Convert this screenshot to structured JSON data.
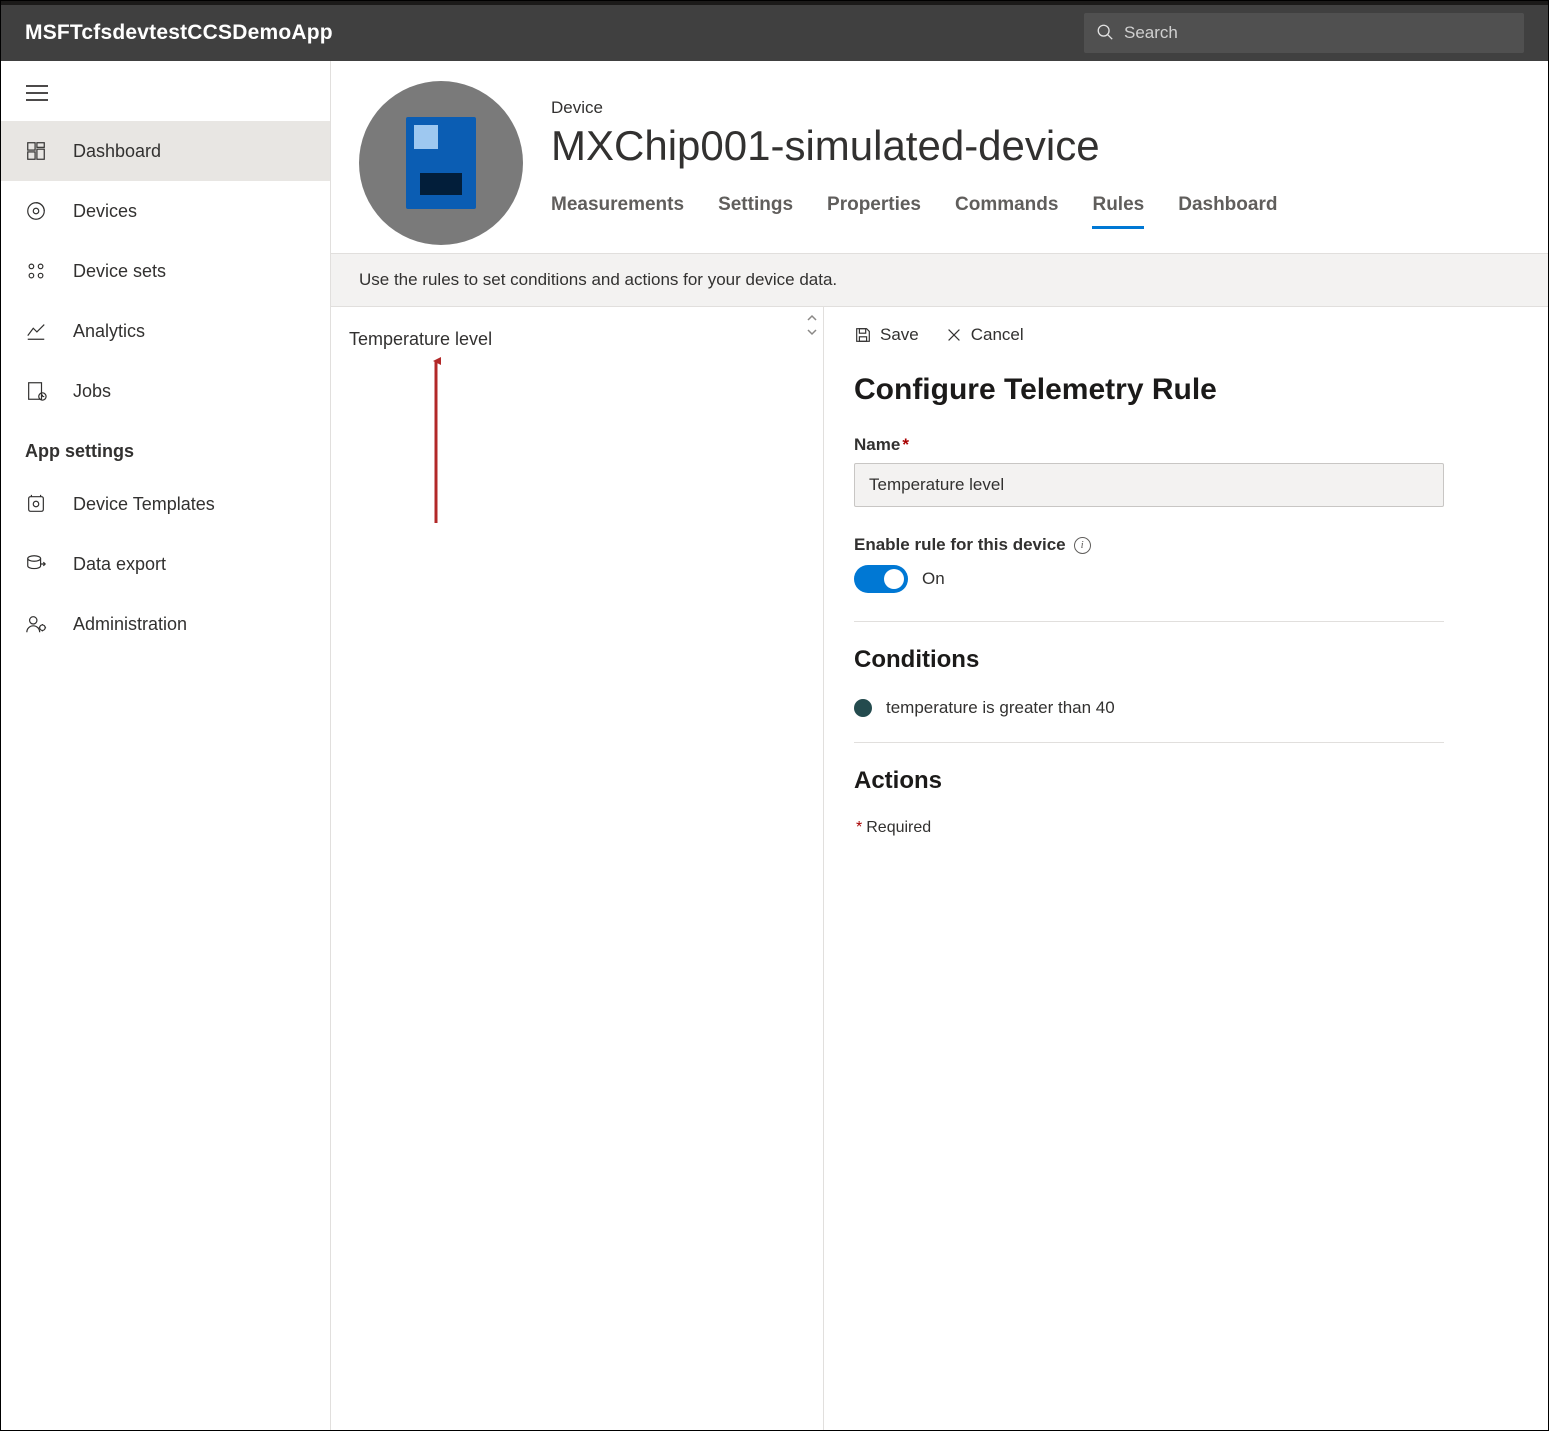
{
  "topbar": {
    "title": "MSFTcfsdevtestCCSDemoApp",
    "search_placeholder": "Search"
  },
  "sidebar": {
    "items": [
      {
        "label": "Dashboard",
        "active": true
      },
      {
        "label": "Devices"
      },
      {
        "label": "Device sets"
      },
      {
        "label": "Analytics"
      },
      {
        "label": "Jobs"
      }
    ],
    "section_header": "App settings",
    "secondary": [
      {
        "label": "Device Templates"
      },
      {
        "label": "Data export"
      },
      {
        "label": "Administration"
      }
    ]
  },
  "device": {
    "eyebrow": "Device",
    "title": "MXChip001-simulated-device",
    "tabs": [
      {
        "label": "Measurements"
      },
      {
        "label": "Settings"
      },
      {
        "label": "Properties"
      },
      {
        "label": "Commands"
      },
      {
        "label": "Rules",
        "active": true
      },
      {
        "label": "Dashboard"
      }
    ],
    "info_strip": "Use the rules to set conditions and actions for your device data."
  },
  "rules_list": {
    "items": [
      "Temperature level"
    ]
  },
  "rule_panel": {
    "save": "Save",
    "cancel": "Cancel",
    "heading": "Configure Telemetry Rule",
    "name_label": "Name",
    "name_value": "Temperature level",
    "enable_label": "Enable rule for this device",
    "toggle_state": "On",
    "conditions_heading": "Conditions",
    "conditions": [
      "temperature is greater than 40"
    ],
    "actions_heading": "Actions",
    "required_note": "Required"
  }
}
